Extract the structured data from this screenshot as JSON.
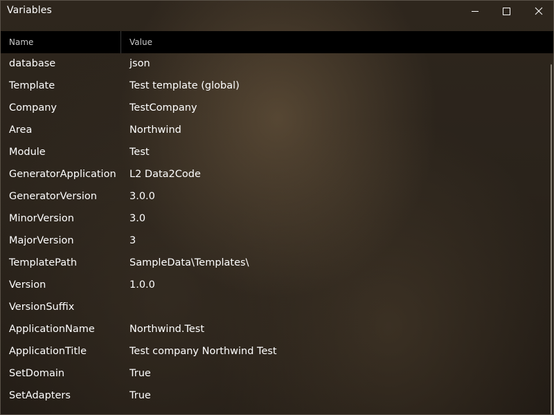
{
  "window": {
    "title": "Variables"
  },
  "grid": {
    "columns": {
      "name": "Name",
      "value": "Value"
    },
    "rows": [
      {
        "name": "database",
        "value": "json"
      },
      {
        "name": "Template",
        "value": "Test template (global)"
      },
      {
        "name": "Company",
        "value": "TestCompany"
      },
      {
        "name": "Area",
        "value": "Northwind"
      },
      {
        "name": "Module",
        "value": "Test"
      },
      {
        "name": "GeneratorApplication",
        "value": "L2 Data2Code"
      },
      {
        "name": "GeneratorVersion",
        "value": "3.0.0"
      },
      {
        "name": "MinorVersion",
        "value": "3.0"
      },
      {
        "name": "MajorVersion",
        "value": "3"
      },
      {
        "name": "TemplatePath",
        "value": "SampleData\\Templates\\"
      },
      {
        "name": "Version",
        "value": "1.0.0"
      },
      {
        "name": "VersionSuffix",
        "value": ""
      },
      {
        "name": "ApplicationName",
        "value": "Northwind.Test"
      },
      {
        "name": "ApplicationTitle",
        "value": "Test company Northwind Test"
      },
      {
        "name": "SetDomain",
        "value": "True"
      },
      {
        "name": "SetAdapters",
        "value": "True"
      }
    ]
  },
  "icons": {
    "minimize": "minimize-icon",
    "maximize": "maximize-icon",
    "close": "close-icon"
  },
  "colors": {
    "header_background": "#000000",
    "text": "#ffffff",
    "header_text": "#c9c9c9"
  }
}
